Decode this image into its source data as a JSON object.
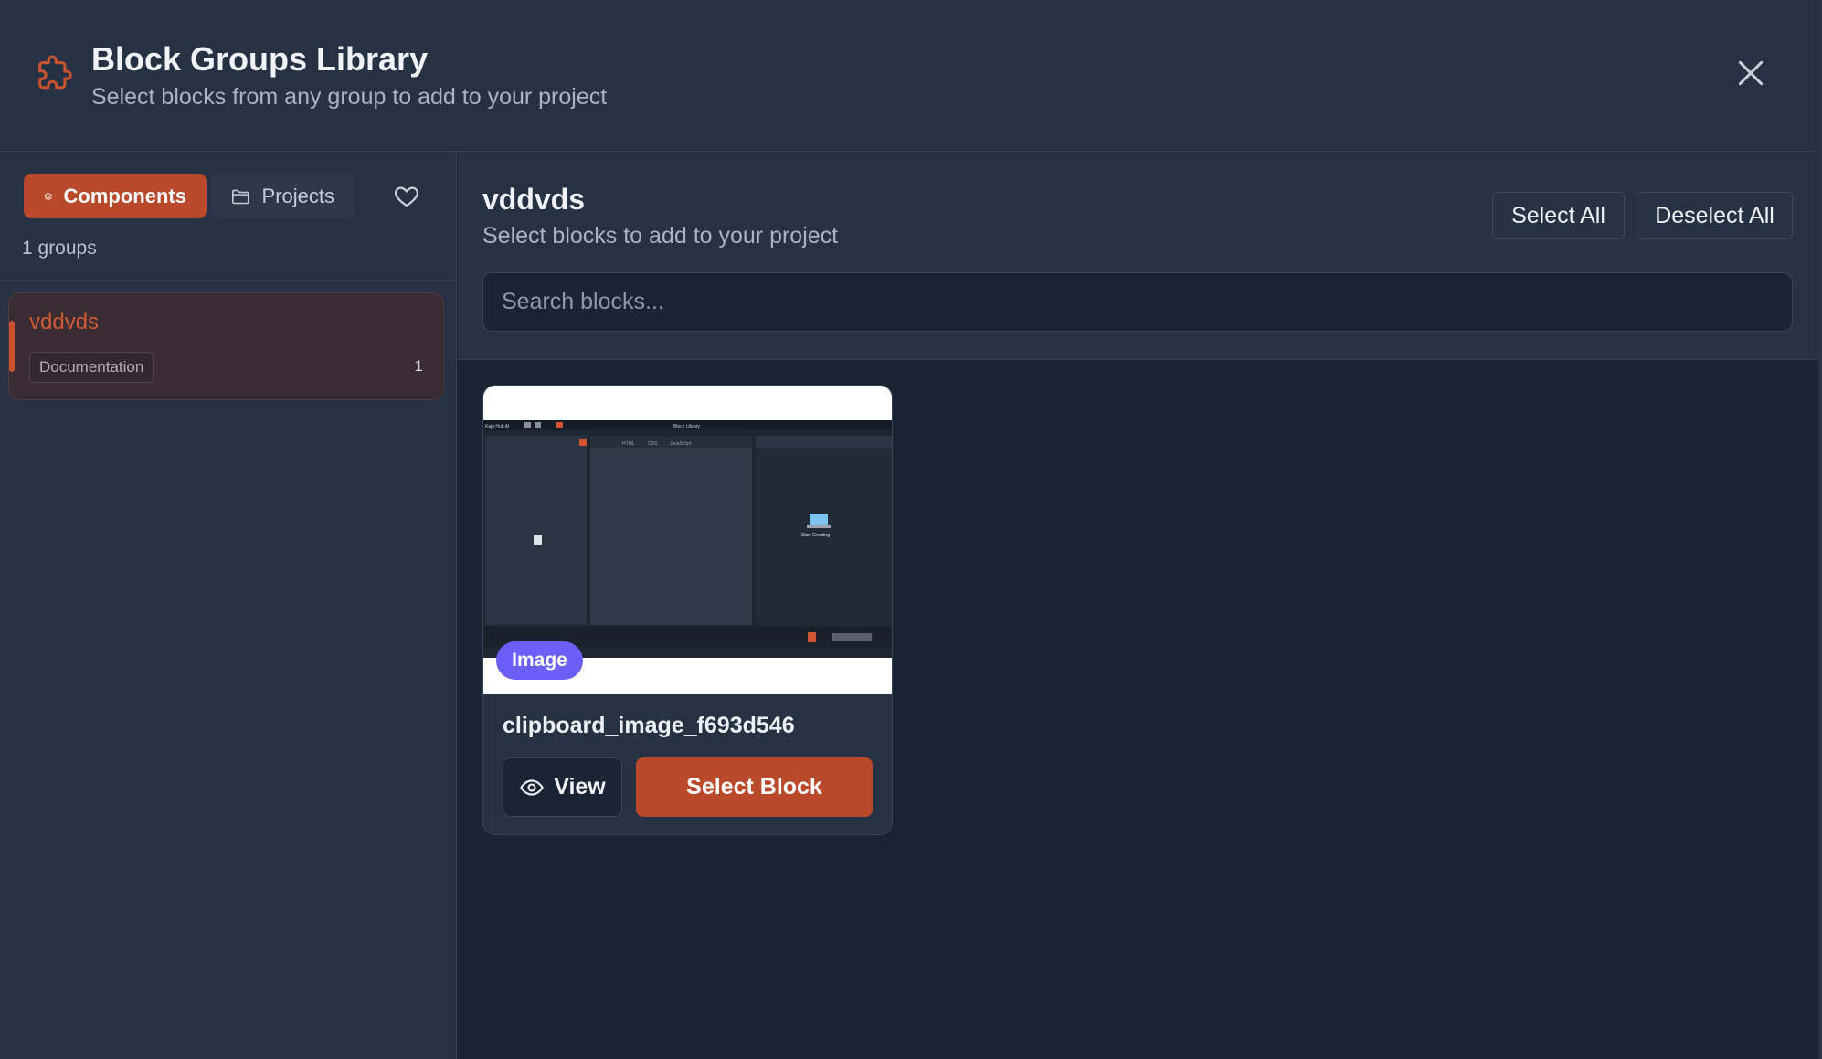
{
  "header": {
    "title": "Block Groups Library",
    "subtitle": "Select blocks from any group to add to your project"
  },
  "sidebar": {
    "tabs": [
      {
        "label": "Components",
        "icon": "layers-icon",
        "active": true
      },
      {
        "label": "Projects",
        "icon": "folder-icon",
        "active": false
      }
    ],
    "favorites_icon": "heart-icon",
    "group_count": "1 groups",
    "groups": [
      {
        "name": "vddvds",
        "tag": "Documentation",
        "count": "1"
      }
    ]
  },
  "main": {
    "group_title": "vddvds",
    "group_subtitle": "Select blocks to add to your project",
    "select_all_label": "Select All",
    "deselect_all_label": "Deselect All",
    "search_placeholder": "Search blocks...",
    "blocks": [
      {
        "name": "clipboard_image_f693d546",
        "badge": "Image",
        "view_label": "View",
        "select_label": "Select Block"
      }
    ]
  },
  "colors": {
    "accent": "#b8492a",
    "badge": "#6a5ff6",
    "background": "#1b2434",
    "panel": "#263244"
  }
}
